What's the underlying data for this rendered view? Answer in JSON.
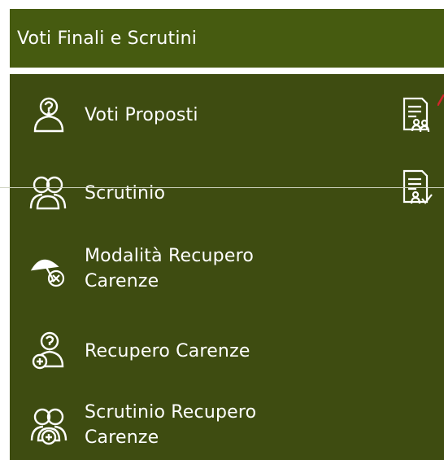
{
  "header": {
    "title": "Voti Finali e Scrutini"
  },
  "menu": {
    "items": [
      {
        "label": "Voti Proposti",
        "icon": "single-user-question-icon"
      },
      {
        "label": "Scrutinio",
        "icon": "group-users-icon"
      },
      {
        "label": "Modalità Recupero",
        "label2": "Carenze",
        "icon": "umbrella-cancel-icon"
      },
      {
        "label": "Recupero Carenze",
        "icon": "single-user-question-plus-icon"
      },
      {
        "label": "Scrutinio Recupero",
        "label2": "Carenze",
        "icon": "group-users-plus-icon"
      }
    ],
    "side_icons": [
      "document-users-icon",
      "document-user-check-icon"
    ]
  },
  "colors": {
    "header_bg": "#465b10",
    "panel_bg": "#3e4c11",
    "text": "#ffffff",
    "accent_red": "#d0262b"
  }
}
